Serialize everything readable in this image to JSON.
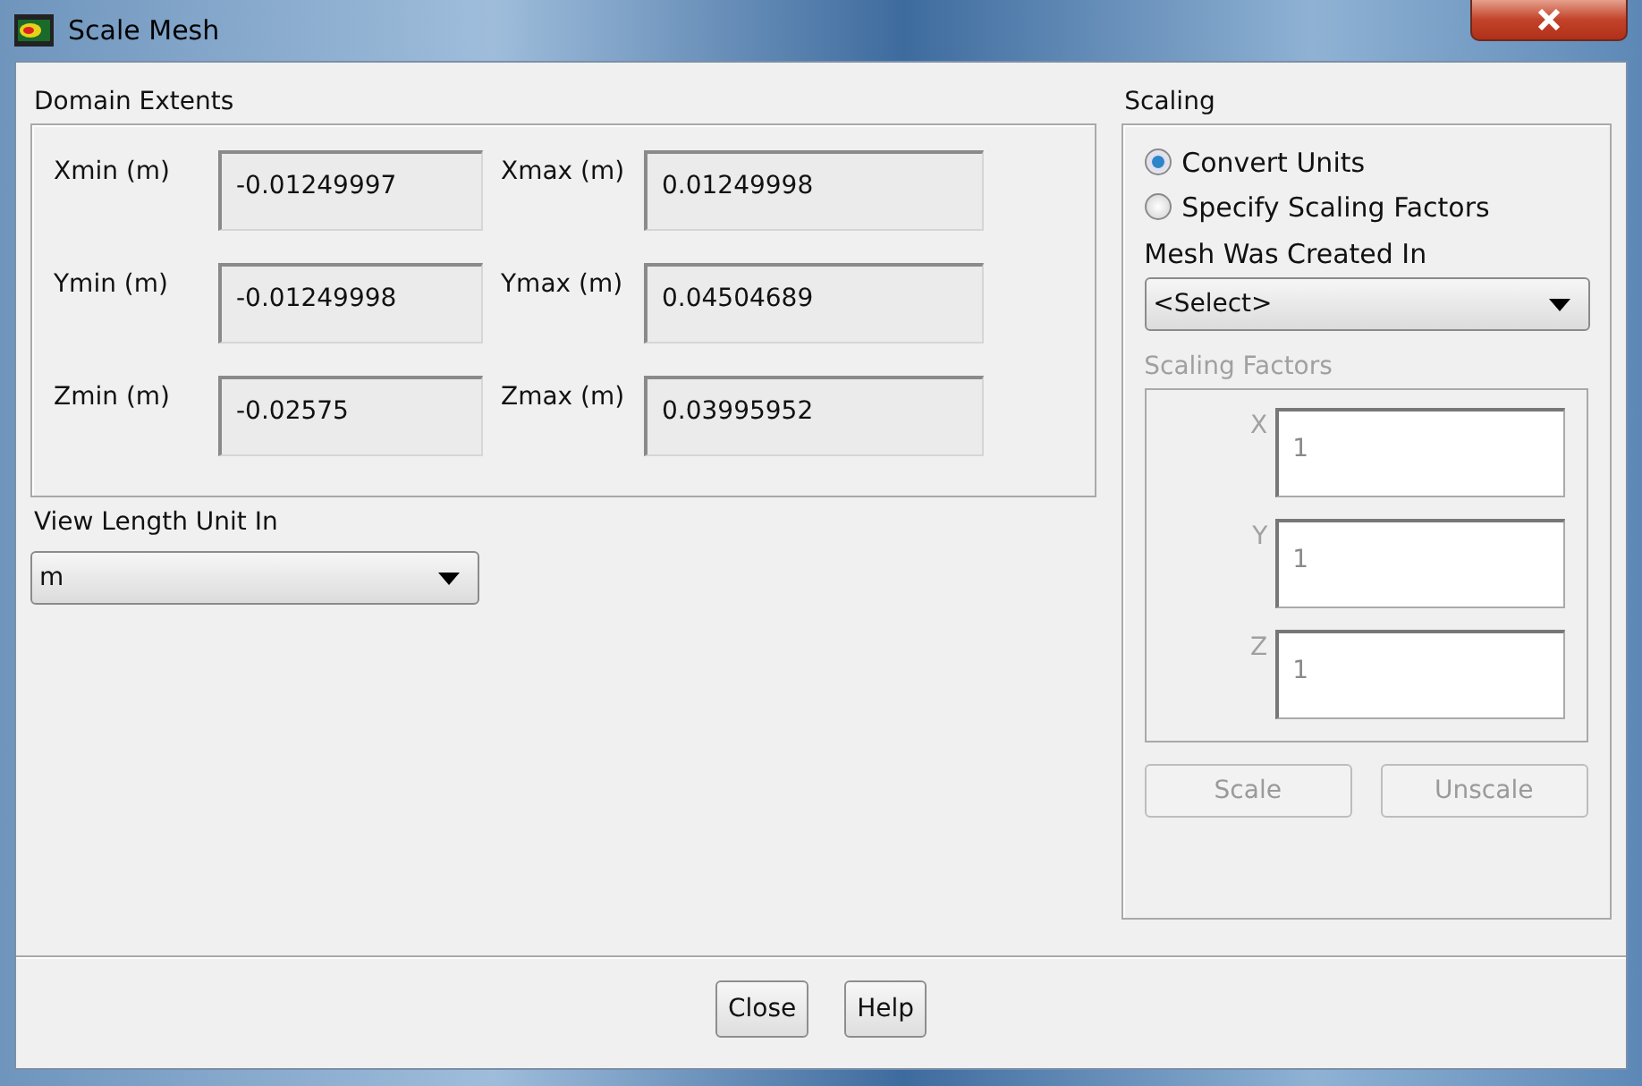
{
  "window": {
    "title": "Scale Mesh"
  },
  "domain_extents": {
    "title": "Domain Extents",
    "fields": [
      {
        "label": "Xmin (m)",
        "value": "-0.01249997"
      },
      {
        "label": "Xmax (m)",
        "value": "0.01249998"
      },
      {
        "label": "Ymin (m)",
        "value": "-0.01249998"
      },
      {
        "label": "Ymax (m)",
        "value": "0.04504689"
      },
      {
        "label": "Zmin (m)",
        "value": "-0.02575"
      },
      {
        "label": "Zmax (m)",
        "value": "0.03995952"
      }
    ]
  },
  "view_length_unit": {
    "label": "View Length Unit In",
    "value": "m"
  },
  "scaling": {
    "title": "Scaling",
    "options": [
      {
        "label": "Convert Units",
        "selected": true
      },
      {
        "label": "Specify Scaling Factors",
        "selected": false
      }
    ],
    "mesh_created_in": {
      "label": "Mesh Was Created In",
      "value": "<Select>"
    },
    "scaling_factors": {
      "title": "Scaling Factors",
      "disabled": true,
      "fields": [
        {
          "label": "X",
          "value": "1"
        },
        {
          "label": "Y",
          "value": "1"
        },
        {
          "label": "Z",
          "value": "1"
        }
      ]
    },
    "buttons": [
      {
        "label": "Scale",
        "disabled": true
      },
      {
        "label": "Unscale",
        "disabled": true
      }
    ]
  },
  "footer_buttons": [
    {
      "label": "Close",
      "disabled": false
    },
    {
      "label": "Help",
      "disabled": false
    }
  ]
}
